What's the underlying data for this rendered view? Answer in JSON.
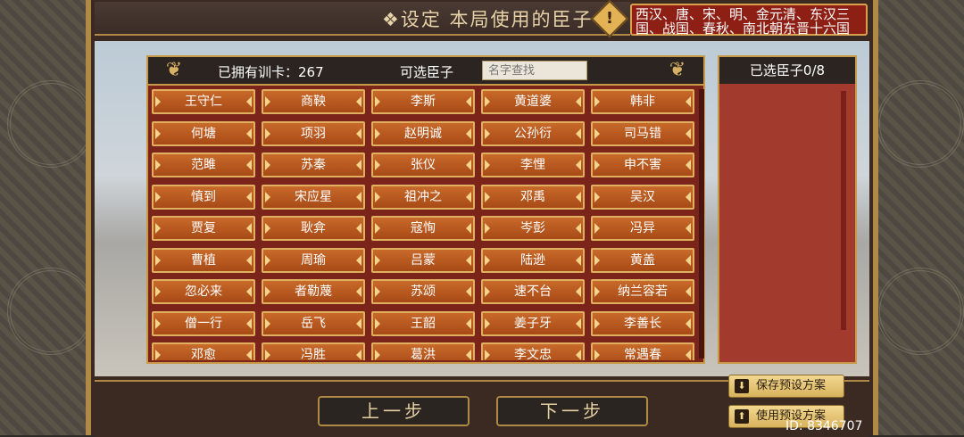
{
  "header": {
    "title": "❖设定 本局使用的臣子❖",
    "warn_icon": "!",
    "dynasties": "西汉、唐、宋、明、金元清、东汉三国、战国、春秋、南北朝东晋十六国"
  },
  "panel": {
    "owned_label": "已拥有训卡：267",
    "available_label": "可选臣子",
    "search_placeholder": "名字查找",
    "ornament_icon": "❦"
  },
  "ministers": [
    "王守仁",
    "商鞅",
    "李斯",
    "黄道婆",
    "韩非",
    "何塘",
    "项羽",
    "赵明诚",
    "公孙衍",
    "司马错",
    "范雎",
    "苏秦",
    "张仪",
    "李悝",
    "申不害",
    "慎到",
    "宋应星",
    "祖冲之",
    "邓禹",
    "吴汉",
    "贾复",
    "耿弇",
    "寇恂",
    "岑彭",
    "冯异",
    "曹植",
    "周瑜",
    "吕蒙",
    "陆逊",
    "黄盖",
    "忽必来",
    "者勒蔑",
    "苏颂",
    "速不台",
    "纳兰容若",
    "僧一行",
    "岳飞",
    "王韶",
    "姜子牙",
    "李善长",
    "邓愈",
    "冯胜",
    "葛洪",
    "李文忠",
    "常遇春"
  ],
  "selected": {
    "header": "已选臣子0/8"
  },
  "buttons": {
    "prev": "上一步",
    "next": "下一步",
    "save_preset": "保存预设方案",
    "use_preset": "使用预设方案",
    "save_icon": "⬇",
    "use_icon": "⬆"
  },
  "footer": {
    "uid": "ID: 8346707"
  },
  "colors": {
    "cell": "#b85620",
    "panel": "#7a241a",
    "gold": "#c89a48"
  }
}
